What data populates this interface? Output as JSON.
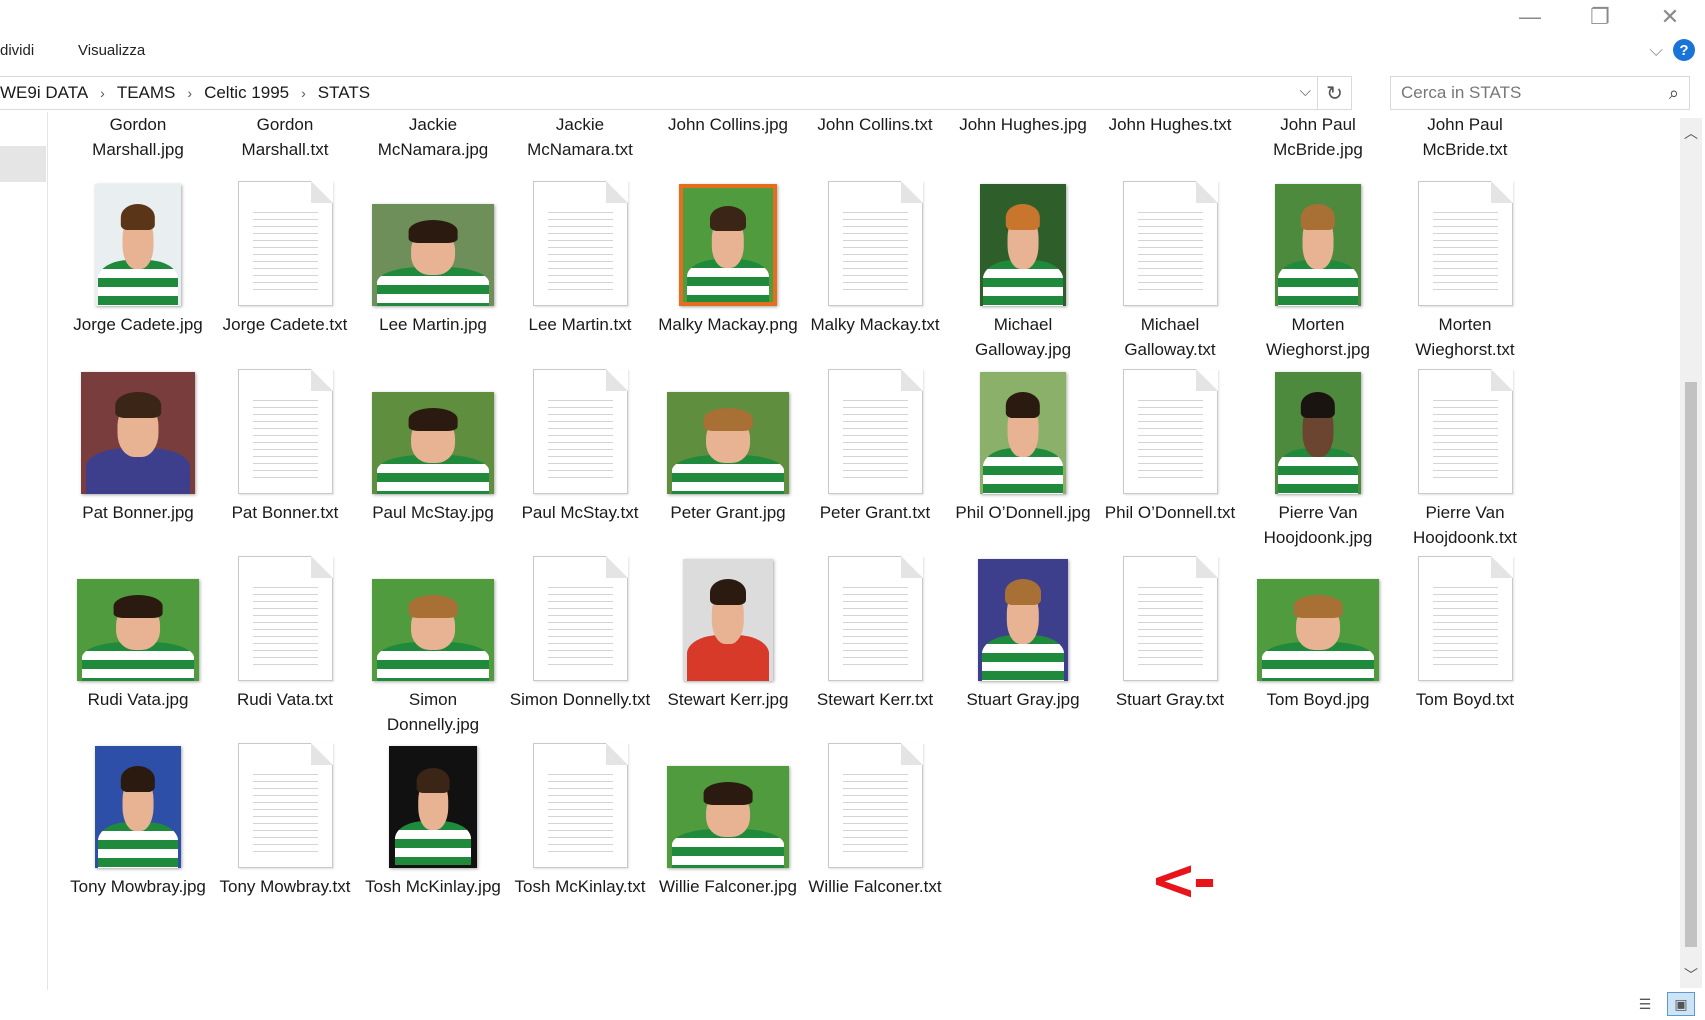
{
  "window": {
    "minimize": "—",
    "maximize": "❐",
    "close": "✕"
  },
  "ribbon": {
    "tabs": [
      "dividi",
      "Visualizza"
    ],
    "collapse": "⌵",
    "help": "?"
  },
  "address": {
    "crumbs": [
      "WE9i DATA",
      "TEAMS",
      "Celtic 1995",
      "STATS"
    ],
    "separator": "›",
    "dropdown": "⌵",
    "refresh": "↻"
  },
  "search": {
    "placeholder": "Cerca in STATS",
    "icon": "⌕"
  },
  "scroll": {
    "up": "︿",
    "down": "﹀"
  },
  "colors": {
    "accent": "#1a73d6",
    "arrow": "#e8141c",
    "shirt_green": "#1f8a3b"
  },
  "annotation": "<-",
  "files": [
    {
      "name": "Gordon Marshall.jpg",
      "type": "label-only"
    },
    {
      "name": "Gordon Marshall.txt",
      "type": "label-only"
    },
    {
      "name": "Jackie McNamara.jpg",
      "type": "label-only"
    },
    {
      "name": "Jackie McNamara.txt",
      "type": "label-only"
    },
    {
      "name": "John Collins.jpg",
      "type": "label-only"
    },
    {
      "name": "John Collins.txt",
      "type": "label-only"
    },
    {
      "name": "John Hughes.jpg",
      "type": "label-only"
    },
    {
      "name": "John Hughes.txt",
      "type": "label-only"
    },
    {
      "name": "John Paul McBride.jpg",
      "type": "label-only"
    },
    {
      "name": "John Paul McBride.txt",
      "type": "label-only"
    },
    {
      "name": "Jorge Cadete.jpg",
      "type": "photo",
      "shape": "portrait",
      "bg": "#e9eef0",
      "hair": "#5a3518"
    },
    {
      "name": "Jorge Cadete.txt",
      "type": "doc"
    },
    {
      "name": "Lee Martin.jpg",
      "type": "photo",
      "shape": "landscape",
      "bg": "#6f8f5a",
      "hair": "#2a1a10"
    },
    {
      "name": "Lee Martin.txt",
      "type": "doc"
    },
    {
      "name": "Malky Mackay.png",
      "type": "photo",
      "shape": "card",
      "bg": "#4f9b3d",
      "hair": "#3a2516",
      "frame": "#e36f1e"
    },
    {
      "name": "Malky Mackay.txt",
      "type": "doc"
    },
    {
      "name": "Michael Galloway.jpg",
      "type": "photo",
      "shape": "portrait",
      "bg": "#2e5f2a",
      "hair": "#c8762d"
    },
    {
      "name": "Michael Galloway.txt",
      "type": "doc"
    },
    {
      "name": "Morten Wieghorst.jpg",
      "type": "photo",
      "shape": "portrait",
      "bg": "#4e8a3e",
      "hair": "#a87035"
    },
    {
      "name": "Morten Wieghorst.txt",
      "type": "doc"
    },
    {
      "name": "Pat Bonner.jpg",
      "type": "photo",
      "shape": "landscape-tall",
      "bg": "#7a3d3d",
      "hair": "#3a2516",
      "shirt": "#3d3f8c"
    },
    {
      "name": "Pat Bonner.txt",
      "type": "doc"
    },
    {
      "name": "Paul McStay.jpg",
      "type": "photo",
      "shape": "landscape",
      "bg": "#5f8f3e",
      "hair": "#2a1a10"
    },
    {
      "name": "Paul McStay.txt",
      "type": "doc"
    },
    {
      "name": "Peter Grant.jpg",
      "type": "photo",
      "shape": "landscape",
      "bg": "#5f8f3e",
      "hair": "#a87035"
    },
    {
      "name": "Peter Grant.txt",
      "type": "doc"
    },
    {
      "name": "Phil O’Donnell.jpg",
      "type": "photo",
      "shape": "portrait",
      "bg": "#8bb06a",
      "hair": "#2a1a10"
    },
    {
      "name": "Phil O’Donnell.txt",
      "type": "doc"
    },
    {
      "name": "Pierre Van Hoojdoonk.jpg",
      "type": "photo",
      "shape": "portrait",
      "bg": "#4e8a3e",
      "hair": "#1a1410",
      "skin": "#6b4530"
    },
    {
      "name": "Pierre Van Hoojdoonk.txt",
      "type": "doc"
    },
    {
      "name": "Rudi Vata.jpg",
      "type": "photo",
      "shape": "landscape",
      "bg": "#4f9b3d",
      "hair": "#2a1a10"
    },
    {
      "name": "Rudi Vata.txt",
      "type": "doc"
    },
    {
      "name": "Simon Donnelly.jpg",
      "type": "photo",
      "shape": "landscape",
      "bg": "#4f9b3d",
      "hair": "#a87035"
    },
    {
      "name": "Simon Donnelly.txt",
      "type": "doc"
    },
    {
      "name": "Stewart Kerr.jpg",
      "type": "photo",
      "shape": "portrait-narrow",
      "bg": "#dcdcdc",
      "hair": "#2a1a10",
      "shirt": "#d83a2a"
    },
    {
      "name": "Stewart Kerr.txt",
      "type": "doc"
    },
    {
      "name": "Stuart Gray.jpg",
      "type": "photo",
      "shape": "portrait-narrow",
      "bg": "#3d3f8c",
      "hair": "#a87035"
    },
    {
      "name": "Stuart Gray.txt",
      "type": "doc"
    },
    {
      "name": "Tom Boyd.jpg",
      "type": "photo",
      "shape": "landscape",
      "bg": "#4f9b3d",
      "hair": "#a87035"
    },
    {
      "name": "Tom Boyd.txt",
      "type": "doc"
    },
    {
      "name": "Tony Mowbray.jpg",
      "type": "photo",
      "shape": "portrait",
      "bg": "#2d4fa8",
      "hair": "#2a1a10"
    },
    {
      "name": "Tony Mowbray.txt",
      "type": "doc"
    },
    {
      "name": "Tosh McKinlay.jpg",
      "type": "photo",
      "shape": "card-black",
      "bg": "#111111",
      "hair": "#3a2516"
    },
    {
      "name": "Tosh McKinlay.txt",
      "type": "doc"
    },
    {
      "name": "Willie Falconer.jpg",
      "type": "photo",
      "shape": "landscape",
      "bg": "#4f9b3d",
      "hair": "#2a1a10"
    },
    {
      "name": "Willie Falconer.txt",
      "type": "doc"
    }
  ]
}
